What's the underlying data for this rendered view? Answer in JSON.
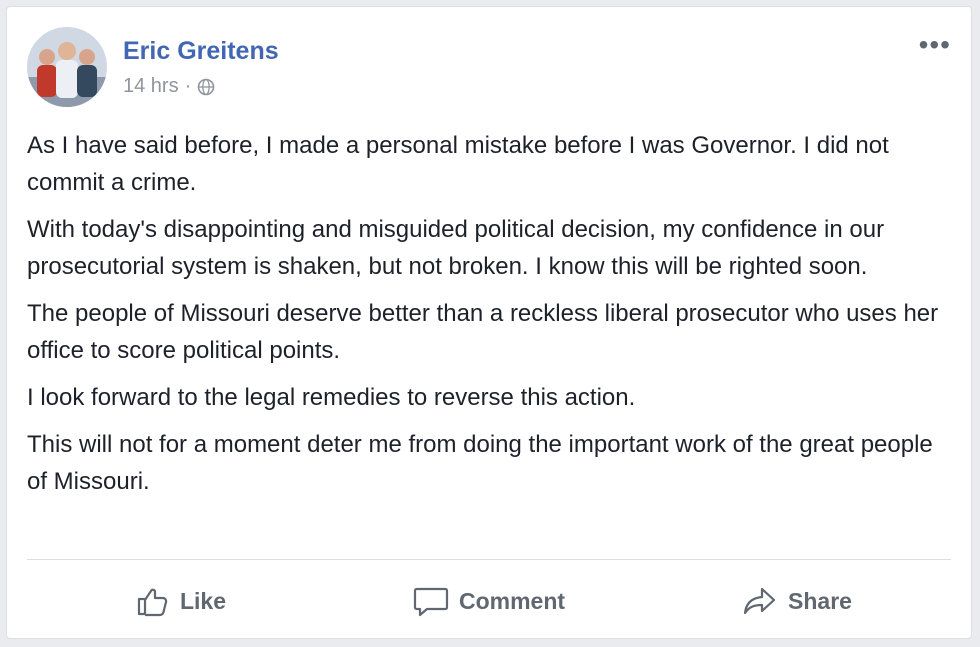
{
  "post": {
    "author": "Eric Greitens",
    "time": "14 hrs",
    "separator": "·",
    "privacy_icon": "globe-icon",
    "more_label": "•••",
    "paragraphs": [
      "As I have said before, I made a personal mistake before I was Governor. I did not commit a crime.",
      "With today's disappointing and misguided political decision, my confidence in our prosecutorial system is shaken, but not broken. I know this will be righted soon.",
      "The people of Missouri deserve better than a reckless liberal prosecutor who uses her office to score political points.",
      "I look forward to the legal remedies to reverse this action.",
      "This will not for a moment deter me from doing the important work of the great people of Missouri."
    ]
  },
  "actions": {
    "like": "Like",
    "comment": "Comment",
    "share": "Share"
  },
  "colors": {
    "author": "#4267b2",
    "meta": "#90949c",
    "text": "#1d2129",
    "action": "#606770"
  }
}
